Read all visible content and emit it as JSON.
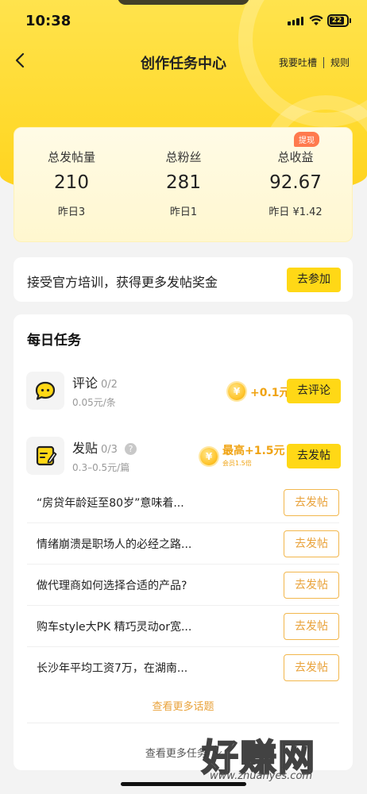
{
  "status": {
    "time": "10:38",
    "battery": "22"
  },
  "nav": {
    "title": "创作任务中心",
    "feedback": "我要吐槽",
    "rules": "规则"
  },
  "stats": {
    "tag": "提现",
    "items": [
      {
        "label": "总发帖量",
        "value": "210",
        "sub": "昨日3"
      },
      {
        "label": "总粉丝",
        "value": "281",
        "sub": "昨日1"
      },
      {
        "label": "总收益",
        "value": "92.67",
        "sub": "昨日 ¥1.42"
      }
    ]
  },
  "training": {
    "text": "接受官方培训，获得更多发帖奖金",
    "button": "去参加"
  },
  "daily": {
    "title": "每日任务",
    "tasks": [
      {
        "name": "评论",
        "count": "0/2",
        "price": "0.05元/条",
        "reward": "+0.1元",
        "button": "去评论",
        "icon": "comment-icon"
      },
      {
        "name": "发贴",
        "count": "0/3",
        "price": "0.3–0.5元/篇",
        "reward": "最高+1.5元",
        "reward_sub": "会员1.5倍",
        "button": "去发帖",
        "icon": "edit-post-icon"
      }
    ],
    "topics": [
      {
        "title": "“房贷年龄延至80岁”意味着...",
        "button": "去发帖"
      },
      {
        "title": "情绪崩溃是职场人的必经之路...",
        "button": "去发帖"
      },
      {
        "title": "做代理商如何选择合适的产品?",
        "button": "去发帖"
      },
      {
        "title": "购车style大PK 精巧灵动or宽...",
        "button": "去发帖"
      },
      {
        "title": "长沙年平均工资7万，在湖南...",
        "button": "去发帖"
      }
    ],
    "more_topics": "查看更多话题",
    "more_tasks": "查看更多任务"
  },
  "coin_symbol": "¥",
  "watermark": {
    "text": "好赚网",
    "url": "www.zhuanyes.com"
  },
  "colors": {
    "accent": "#ffd816",
    "reward": "#f0a312",
    "tag": "#ff7a4d"
  }
}
